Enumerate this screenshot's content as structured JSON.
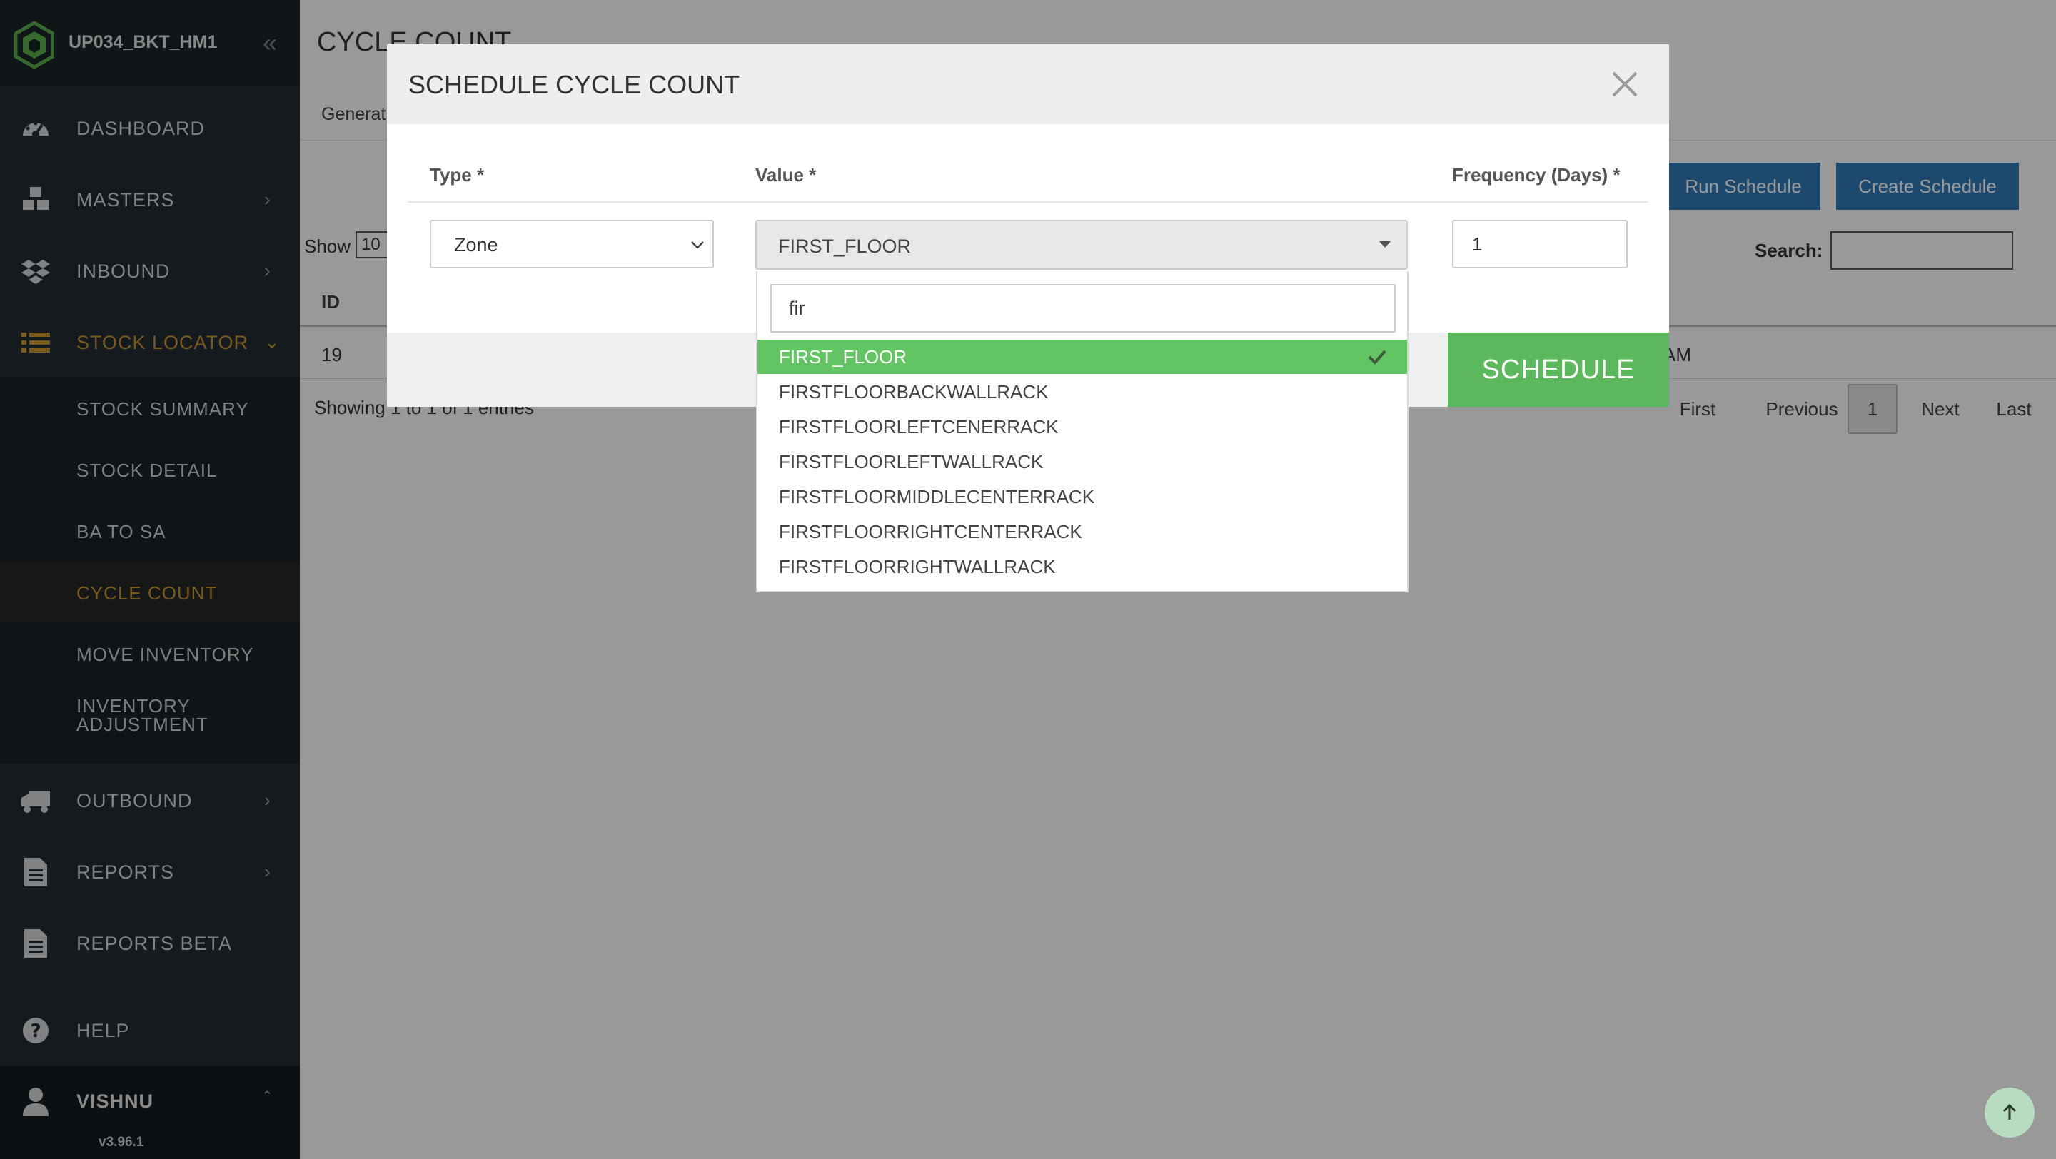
{
  "sidebar": {
    "brand": "UP034_BKT_HM1",
    "menu": [
      {
        "label": "DASHBOARD"
      },
      {
        "label": "MASTERS"
      },
      {
        "label": "INBOUND"
      },
      {
        "label": "STOCK LOCATOR"
      },
      {
        "label": "OUTBOUND"
      },
      {
        "label": "REPORTS"
      },
      {
        "label": "REPORTS BETA"
      },
      {
        "label": "HELP"
      }
    ],
    "submenu": [
      {
        "label": "STOCK SUMMARY"
      },
      {
        "label": "STOCK DETAIL"
      },
      {
        "label": "BA TO SA"
      },
      {
        "label": "CYCLE COUNT"
      },
      {
        "label": "MOVE INVENTORY"
      },
      {
        "label": "INVENTORY ADJUSTMENT"
      }
    ],
    "user": "VISHNU",
    "version": "v3.96.1"
  },
  "main": {
    "title": "CYCLE COUNT",
    "tab": "Generat",
    "run_schedule": "Run Schedule",
    "create_schedule": "Create Schedule",
    "show_label": "Show",
    "show_value": "10",
    "search_label": "Search:",
    "col_id": "ID",
    "row_id": "19",
    "row_time": "AM",
    "showing": "Showing 1 to 1 of 1 entries",
    "pager": {
      "first": "First",
      "previous": "Previous",
      "current": "1",
      "next": "Next",
      "last": "Last"
    }
  },
  "modal": {
    "title": "SCHEDULE CYCLE COUNT",
    "type_label": "Type *",
    "value_label": "Value *",
    "frequency_label": "Frequency (Days) *",
    "type_value": "Zone",
    "value_selected": "FIRST_FLOOR",
    "frequency_value": "1",
    "schedule_button": "SCHEDULE"
  },
  "dropdown": {
    "search_text": "fir",
    "options": [
      "FIRST_FLOOR",
      "FIRSTFLOORBACKWALLRACK",
      "FIRSTFLOORLEFTCENERRACK",
      "FIRSTFLOORLEFTWALLRACK",
      "FIRSTFLOORMIDDLECENTERRACK",
      "FIRSTFLOORRIGHTCENTERRACK",
      "FIRSTFLOORRIGHTWALLRACK"
    ]
  },
  "colors": {
    "accent": "#c8952d",
    "primary": "#337ab7",
    "success": "#5cb85c"
  }
}
